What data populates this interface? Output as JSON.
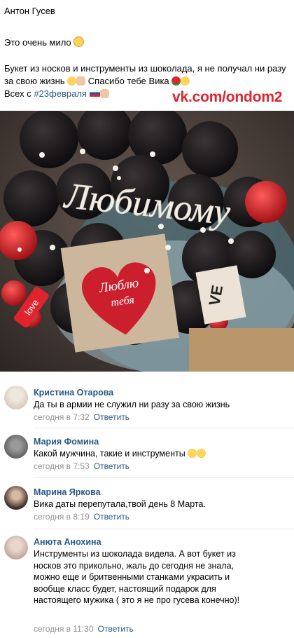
{
  "post": {
    "author": "Антон Гусев",
    "line1": "Это очень мило",
    "line2": "Букет из носков и инструменты из шоколада, я не получал ни разу за свою жизнь",
    "line2b": "Спасибо тебе Вика",
    "line3_prefix": "Всех с ",
    "hashtag": "#23февраля",
    "watermark": "vk.com/ondom2",
    "photo_text_main": "Любимому",
    "photo_text_tag1": "Люблю",
    "photo_text_tag2": "тебя",
    "photo_text_love": "love",
    "photo_text_ve": "VE"
  },
  "comments": [
    {
      "name": "Кристина Отарова",
      "text": "Да ты в армии не служил ни разу за свою жизнь",
      "time": "сегодня в 7:32",
      "reply": "Ответить",
      "avatar_color": "#d8cfc4"
    },
    {
      "name": "Мария Фомина",
      "text": "Какой мужчина, такие и инструменты",
      "time": "сегодня в 7:53",
      "reply": "Ответить",
      "avatar_color": "#6e6e6e"
    },
    {
      "name": "Марина Яркова",
      "text": "Вика даты перепутала,твой день 8 Марта.",
      "time": "сегодня в 8:19",
      "reply": "Ответить",
      "avatar_color": "#4a3a32"
    },
    {
      "name": "Анюта Анохина",
      "text": "Инструменты из шоколада видела. А вот букет из носков это прикольно, жаль до сегодня не знала, можно еще и бритвенными станками украсить и вообще класс будет, настоящий подарок для настоящего мужика ( это я не про гусева конечно)!",
      "time": "сегодня в 11:30",
      "reply": "Ответить",
      "avatar_color": "#b9a39a"
    }
  ],
  "colors": {
    "link": "#2a5885",
    "meta": "#939393",
    "watermark": "#e0232d"
  }
}
